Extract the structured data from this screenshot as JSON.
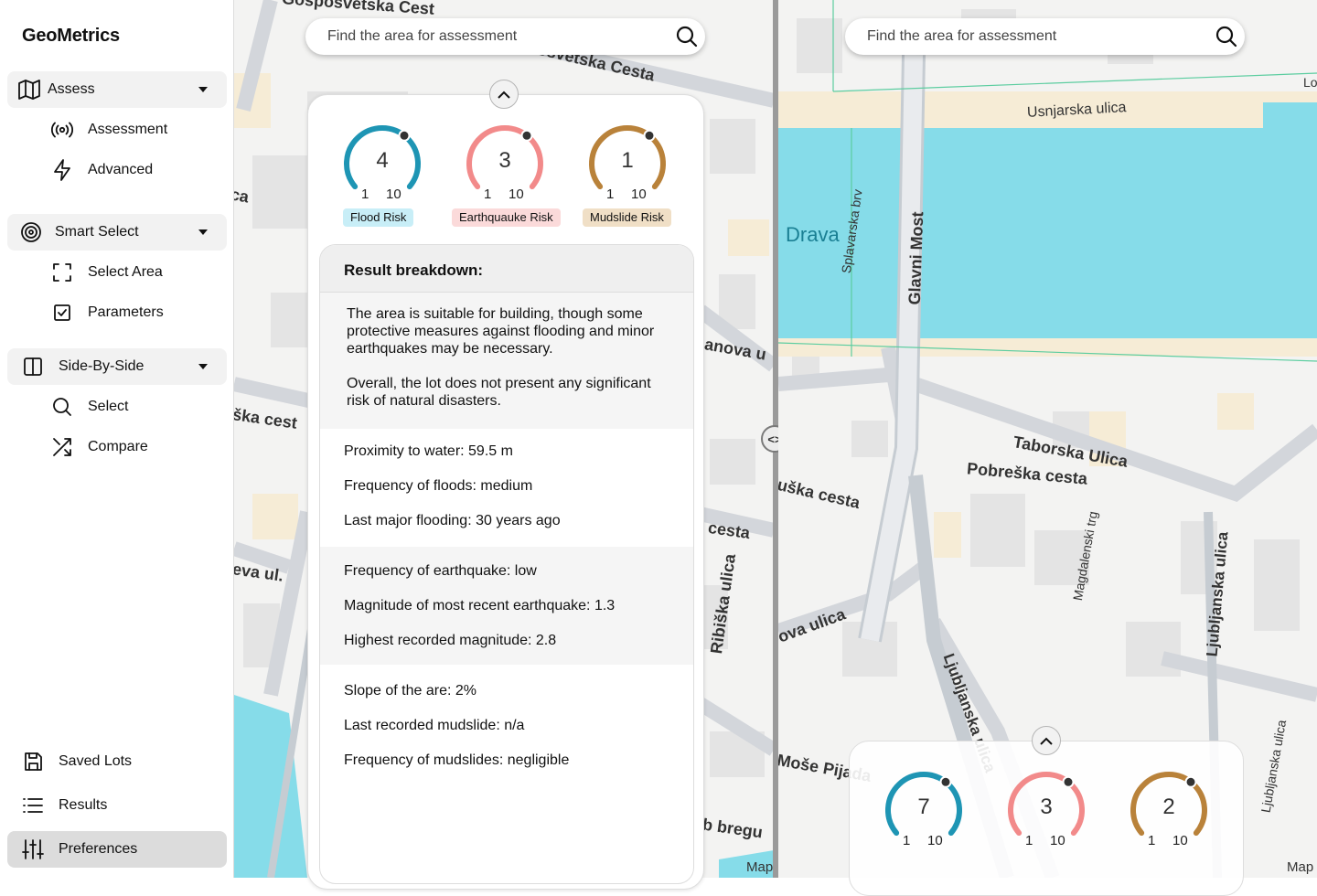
{
  "app": {
    "title": "GeoMetrics"
  },
  "sidebar": {
    "groups": [
      {
        "label": "Assess",
        "icon": "map-icon",
        "items": [
          {
            "label": "Assessment",
            "icon": "radio-signal-icon"
          },
          {
            "label": "Advanced",
            "icon": "lightning-icon"
          }
        ]
      },
      {
        "label": "Smart Select",
        "icon": "target-icon",
        "items": [
          {
            "label": "Select Area",
            "icon": "select-frame-icon"
          },
          {
            "label": "Parameters",
            "icon": "checkbox-icon"
          }
        ]
      },
      {
        "label": "Side-By-Side",
        "icon": "split-panel-icon",
        "items": [
          {
            "label": "Select",
            "icon": "search-icon"
          },
          {
            "label": "Compare",
            "icon": "shuffle-icon"
          }
        ]
      }
    ],
    "bottom": [
      {
        "label": "Saved Lots",
        "icon": "save-icon"
      },
      {
        "label": "Results",
        "icon": "list-icon"
      },
      {
        "label": "Preferences",
        "icon": "sliders-icon",
        "active": true
      }
    ]
  },
  "search": {
    "placeholder": "Find the area for assessment"
  },
  "left_panel": {
    "gauges": [
      {
        "value": "4",
        "min": "1",
        "max": "10",
        "label": "Flood Risk",
        "color": "#1e95b4",
        "tag_bg": "#c8eef7"
      },
      {
        "value": "3",
        "min": "1",
        "max": "10",
        "label": "Earthquauke Risk",
        "color": "#f28a8a",
        "tag_bg": "#fbdada"
      },
      {
        "value": "1",
        "min": "1",
        "max": "10",
        "label": "Mudslide Risk",
        "color": "#b9823a",
        "tag_bg": "#f0dfc6"
      }
    ],
    "breakdown": {
      "title": "Result breakdown:",
      "summary": [
        "The area is suitable for building, though some protective measures against flooding and minor earthquakes may be necessary.",
        "Overall, the lot does not present any significant risk of natural disasters."
      ],
      "flood": [
        "Proximity to water: 59.5 m",
        "Frequency of floods: medium",
        "Last major flooding: 30 years ago"
      ],
      "earthquake": [
        "Frequency of earthquake: low",
        "Magnitude of most recent earthquake: 1.3",
        "Highest recorded magnitude: 2.8"
      ],
      "mudslide": [
        "Slope of the are: 2%",
        "Last recorded mudslide: n/a",
        "Frequency of mudslides: negligible"
      ]
    }
  },
  "right_panel": {
    "gauges": [
      {
        "value": "7",
        "min": "1",
        "max": "10",
        "color": "#1e95b4"
      },
      {
        "value": "3",
        "min": "1",
        "max": "10",
        "color": "#f28a8a"
      },
      {
        "value": "2",
        "min": "1",
        "max": "10",
        "color": "#b9823a"
      }
    ]
  },
  "map_left_labels": [
    "Gosposvetska Cest",
    "osvetska Cesta",
    "ca",
    "anova u",
    "ška cest",
    "cesta",
    "eva ul.",
    "Ribiška ulica",
    "b bregu",
    "Map"
  ],
  "map_right_labels": [
    "Drava",
    "Usnjarska ulica",
    "Splavarska brv",
    "Glavni Most",
    "Taborska Ulica",
    "Pobreška cesta",
    "uška cesta",
    "ova ulica",
    "Magdalenski trg",
    "Ljubljanska ulica",
    "Ljubljanska ulica",
    "Ljubljanska ulica",
    "Moše Pijada",
    "Map",
    "Lo"
  ]
}
